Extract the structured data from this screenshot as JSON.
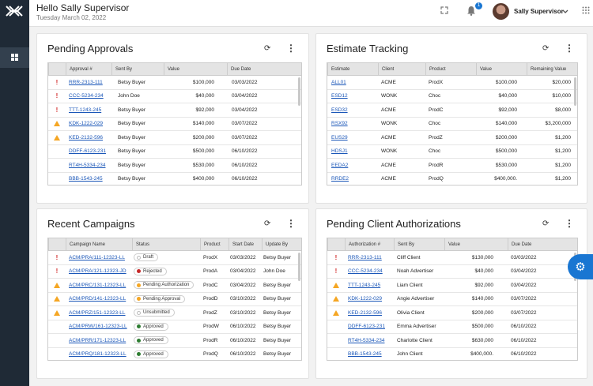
{
  "header": {
    "greeting": "Hello Sally Supervisor",
    "date": "Tuesday March 02, 2022",
    "notification_count": "1",
    "user_name": "Sally Supervisor"
  },
  "icons": {
    "logo": "logo-icon",
    "dashboard": "dashboard-icon",
    "fullscreen": "fullscreen-icon",
    "bell": "bell-icon",
    "chevron": "chevron-down-icon",
    "apps": "grid-icon",
    "refresh": "refresh-icon",
    "menu": "more-vert-icon",
    "settings": "gear-icon"
  },
  "colors": {
    "accent": "#1976d2",
    "sidebar": "#1f2a36",
    "alert_red": "#d32f2f",
    "warning_orange": "#f5a623",
    "status_green": "#2e7d32",
    "status_red": "#c62828"
  },
  "pending_approvals": {
    "title": "Pending Approvals",
    "columns": [
      "",
      "Approval #",
      "Sent By",
      "Value",
      "Due Date"
    ],
    "rows": [
      {
        "flag": "!",
        "id": "RRR-2313-111",
        "by": "Betsy Buyer",
        "value": "$100,000",
        "due": "03/03/2022"
      },
      {
        "flag": "!",
        "id": "CCC-5234-234",
        "by": "John Doe",
        "value": "$40,000",
        "due": "03/04/2022"
      },
      {
        "flag": "!",
        "id": "TTT-1243-245",
        "by": "Betsy Buyer",
        "value": "$92,000",
        "due": "03/04/2022"
      },
      {
        "flag": "warn",
        "id": "KDK-1222-029",
        "by": "Betsy Buyer",
        "value": "$140,000",
        "due": "03/07/2022"
      },
      {
        "flag": "warn",
        "id": "KED-2132-596",
        "by": "Betsy Buyer",
        "value": "$200,000",
        "due": "03/07/2022"
      },
      {
        "flag": "",
        "id": "DDFF-6123-231",
        "by": "Betsy Buyer",
        "value": "$500,000",
        "due": "06/10/2022"
      },
      {
        "flag": "",
        "id": "RT4H-5334-234",
        "by": "Betsy Buyer",
        "value": "$530,000",
        "due": "06/10/2022"
      },
      {
        "flag": "",
        "id": "BBB-1543-245",
        "by": "Betsy Buyer",
        "value": "$400,000",
        "due": "06/10/2022"
      }
    ]
  },
  "estimate_tracking": {
    "title": "Estimate Tracking",
    "columns": [
      "Estimate",
      "Client",
      "Product",
      "Value",
      "Remaining Value"
    ],
    "rows": [
      {
        "id": "ALL01",
        "client": "ACME",
        "product": "ProdX",
        "value": "$100,000",
        "remaining": "$20,000"
      },
      {
        "id": "ESD12",
        "client": "WONK",
        "product": "Choc",
        "value": "$40,000",
        "remaining": "$10,000"
      },
      {
        "id": "ESD32",
        "client": "ACME",
        "product": "ProdC",
        "value": "$92,000",
        "remaining": "$8,000"
      },
      {
        "id": "RSX92",
        "client": "WONK",
        "product": "Choc",
        "value": "$140,000",
        "remaining": "$3,200,000"
      },
      {
        "id": "EUS29",
        "client": "ACME",
        "product": "ProdZ",
        "value": "$200,000",
        "remaining": "$1,200"
      },
      {
        "id": "HDSJ1",
        "client": "WONK",
        "product": "Choc",
        "value": "$500,000",
        "remaining": "$1,200"
      },
      {
        "id": "EEDA2",
        "client": "ACME",
        "product": "ProdR",
        "value": "$530,000",
        "remaining": "$1,200"
      },
      {
        "id": "RRDE2",
        "client": "ACME",
        "product": "ProdQ",
        "value": "$400,000.",
        "remaining": "$1,200"
      }
    ]
  },
  "recent_campaigns": {
    "title": "Recent Campaigns",
    "columns": [
      "",
      "Campaign Name",
      "Status",
      "Product",
      "Start Date",
      "Update By"
    ],
    "rows": [
      {
        "flag": "!",
        "name": "ACM/PRA/111-12323-LL",
        "status": "Draft",
        "dot": "",
        "product": "ProdX",
        "start": "03/03/2022",
        "by": "Betsy Buyer"
      },
      {
        "flag": "!",
        "name": "ACM/PRA/121-12323-JD",
        "status": "Rejected",
        "dot": "#c62828",
        "product": "ProdA",
        "start": "03/04/2022",
        "by": "John Doe"
      },
      {
        "flag": "warn",
        "name": "ACM/PRC/131-12323-LL",
        "status": "Pending Authorization",
        "dot": "#f5a623",
        "product": "ProdC",
        "start": "03/04/2022",
        "by": "Betsy Buyer"
      },
      {
        "flag": "warn",
        "name": "ACM/PRD/141-12323-LL",
        "status": "Pending Approval",
        "dot": "#f5a623",
        "product": "ProdD",
        "start": "03/10/2022",
        "by": "Betsy Buyer"
      },
      {
        "flag": "warn",
        "name": "ACM/PRZ/151-12323-LL",
        "status": "Unsubmitted",
        "dot": "",
        "product": "ProdZ",
        "start": "03/10/2022",
        "by": "Betsy Buyer"
      },
      {
        "flag": "",
        "name": "ACM/PRW/161-12323-LL",
        "status": "Approved",
        "dot": "#2e7d32",
        "product": "ProdW",
        "start": "06/10/2022",
        "by": "Betsy Buyer"
      },
      {
        "flag": "",
        "name": "ACM/PRR/171-12323-LL",
        "status": "Approved",
        "dot": "#2e7d32",
        "product": "ProdR",
        "start": "06/10/2022",
        "by": "Betsy Buyer"
      },
      {
        "flag": "",
        "name": "ACM/PRQ/181-12323-LL",
        "status": "Approved",
        "dot": "#2e7d32",
        "product": "ProdQ",
        "start": "06/10/2022",
        "by": "Betsy Buyer"
      }
    ]
  },
  "pending_client_auth": {
    "title": "Pending Client Authorizations",
    "columns": [
      "",
      "Authorization #",
      "Sent By",
      "Value",
      "Due Date"
    ],
    "rows": [
      {
        "flag": "!",
        "id": "RRR-2313-111",
        "by": "Cliff Client",
        "value": "$130,000",
        "due": "03/03/2022"
      },
      {
        "flag": "!",
        "id": "CCC-5234-234",
        "by": "Noah Advertiser",
        "value": "$40,000",
        "due": "03/04/2022"
      },
      {
        "flag": "warn",
        "id": "TTT-1243-245",
        "by": "Liam Client",
        "value": "$92,000",
        "due": "03/04/2022"
      },
      {
        "flag": "warn",
        "id": "KDK-1222-029",
        "by": "Angie Advertiser",
        "value": "$140,000",
        "due": "03/07/2022"
      },
      {
        "flag": "warn",
        "id": "KED-2132-596",
        "by": "Olivia Client",
        "value": "$200,000",
        "due": "03/07/2022"
      },
      {
        "flag": "",
        "id": "DDFF-6123-231",
        "by": "Emma Advertiser",
        "value": "$500,000",
        "due": "06/10/2022"
      },
      {
        "flag": "",
        "id": "RT4H-5334-234",
        "by": "Charlotte Client",
        "value": "$630,000",
        "due": "06/10/2022"
      },
      {
        "flag": "",
        "id": "BBB-1543-245",
        "by": "John Client",
        "value": "$400,000.",
        "due": "06/10/2022"
      }
    ]
  }
}
